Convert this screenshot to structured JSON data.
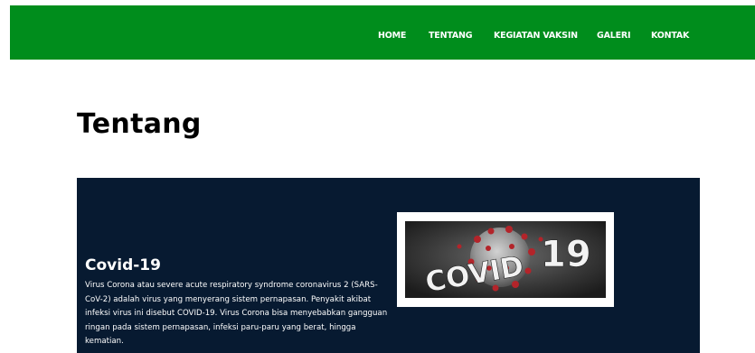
{
  "nav": {
    "items": [
      {
        "label": "HOME"
      },
      {
        "label": "TENTANG"
      },
      {
        "label": "KEGIATAN VAKSIN"
      },
      {
        "label": "GALERI"
      },
      {
        "label": "KONTAK"
      }
    ]
  },
  "page": {
    "title": "Tentang"
  },
  "hero": {
    "heading": "Covid-19",
    "description": "Virus Corona atau severe acute respiratory syndrome coronavirus 2 (SARS-CoV-2) adalah virus yang menyerang sistem pernapasan. Penyakit akibat infeksi virus ini disebut COVID-19. Virus Corona bisa menyebabkan gangguan ringan pada sistem pernapasan, infeksi paru-paru yang berat, hingga kematian.",
    "image": {
      "text_left": "COVID",
      "text_right": "19",
      "icon": "coronavirus-image"
    }
  },
  "colors": {
    "navbar_bg": "#008d1c",
    "hero_bg": "#071a31",
    "text_light": "#ffffff",
    "text_dark": "#000000"
  }
}
